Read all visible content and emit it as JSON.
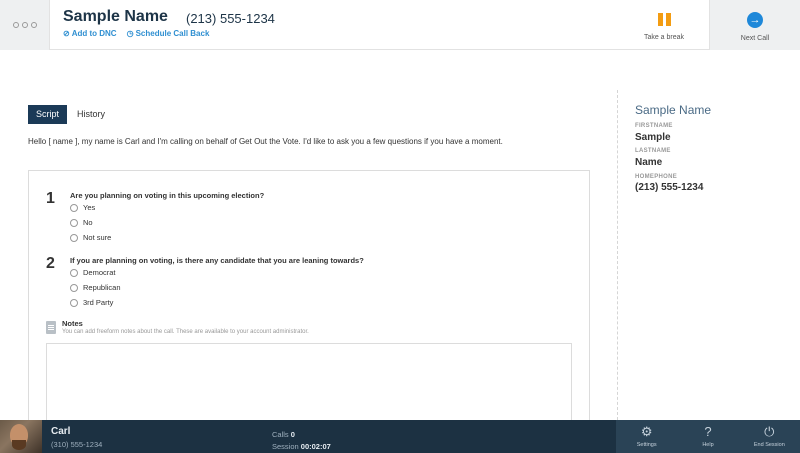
{
  "header": {
    "menu_icon": "ellipsis-dots-icon",
    "contact_name": "Sample Name",
    "contact_phone": "(213) 555-1234",
    "add_dnc": "Add to DNC",
    "schedule_callback": "Schedule Call Back",
    "take_break": "Take a break",
    "next_call": "Next Call"
  },
  "tabs": [
    "Script",
    "History"
  ],
  "active_tab": "Script",
  "intro": "Hello [ name ], my name is Carl and I'm calling on behalf of Get Out the Vote. I'd like to ask you a few questions if you have a moment.",
  "questions": [
    {
      "number": "1",
      "text": "Are you planning on voting in this upcoming election?",
      "options": [
        "Yes",
        "No",
        "Not sure"
      ]
    },
    {
      "number": "2",
      "text": "If you are planning on voting, is there any candidate that you are leaning towards?",
      "options": [
        "Democrat",
        "Republican",
        "3rd Party"
      ]
    }
  ],
  "notes": {
    "title": "Notes",
    "description": "You can add freeform notes about the call. These are available to your account administrator.",
    "value": ""
  },
  "contact_panel": {
    "name": "Sample Name",
    "firstname_label": "FIRSTNAME",
    "firstname": "Sample",
    "lastname_label": "LASTNAME",
    "lastname": "Name",
    "homephone_label": "HOMEPHONE",
    "homephone": "(213) 555-1234"
  },
  "footer": {
    "caller_name": "Carl",
    "caller_phone": "(310) 555-1234",
    "calls_label": "Calls",
    "calls_value": "0",
    "session_label": "Session",
    "session_value": "00:02:07",
    "settings": "Settings",
    "help": "Help",
    "end_session": "End Session"
  },
  "colors": {
    "accent_blue": "#2f8fd1",
    "break_orange": "#f39c12",
    "next_blue": "#1e88d9",
    "tab_active": "#1b3a57",
    "footer_bg": "#1c3142"
  }
}
